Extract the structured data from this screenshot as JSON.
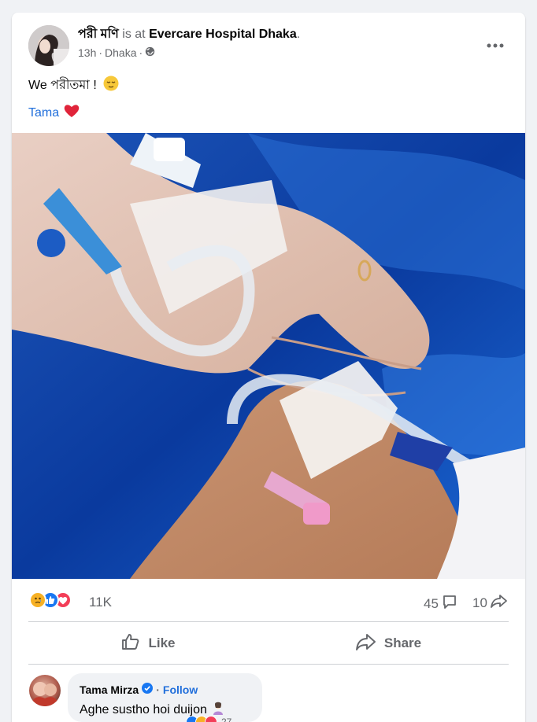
{
  "post": {
    "author": "পরী মণি",
    "is_at": "is at",
    "place": "Evercare Hospital Dhaka",
    "place_suffix": ".",
    "time": "13h",
    "location": "Dhaka",
    "sep1": "·",
    "sep2": "·",
    "text": "We পরীতমা !",
    "tag": "Tama",
    "icons": {
      "more": "more-options-icon",
      "privacy": "globe-icon"
    }
  },
  "stats": {
    "reactions": "11K",
    "comments": "45",
    "shares": "10",
    "reaction_types": [
      "sad",
      "like",
      "love"
    ]
  },
  "actions": {
    "like": "Like",
    "share": "Share"
  },
  "comment": {
    "author": "Tama Mirza",
    "dot": "·",
    "follow": "Follow",
    "text": "Aghe sustho hoi duijon",
    "reaction_count": "27"
  },
  "colors": {
    "link": "#216fdb",
    "like_blue": "#1877f2",
    "love_red": "#f33e58",
    "sad_yellow": "#f7b125"
  }
}
